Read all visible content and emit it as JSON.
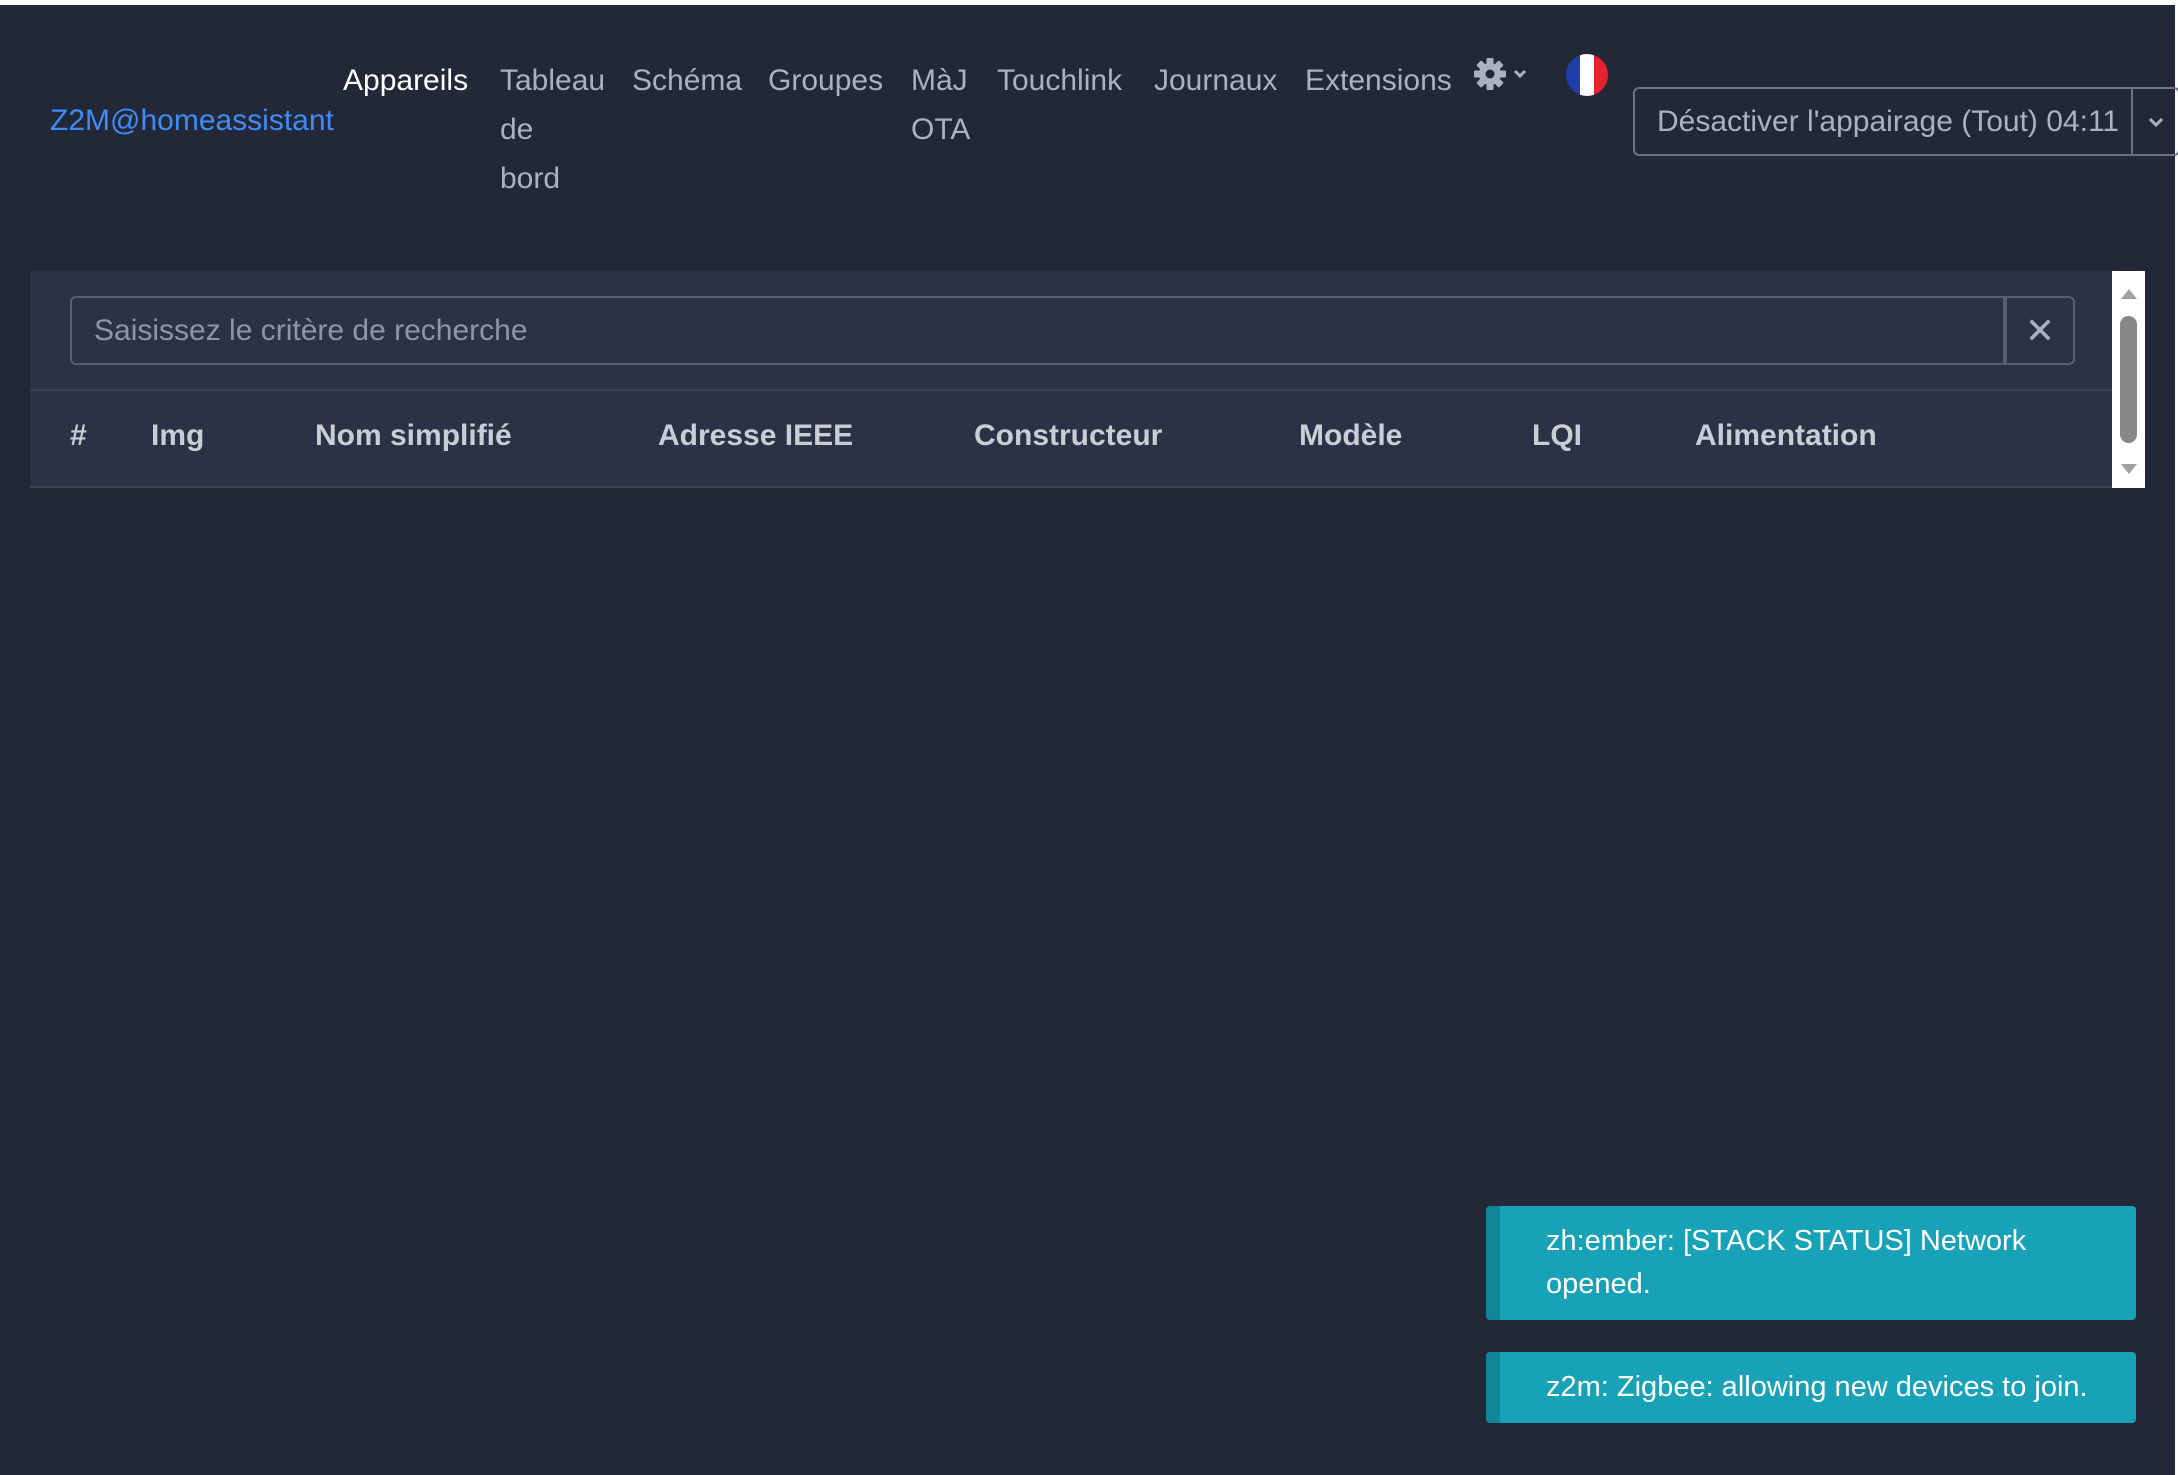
{
  "brand": "Z2M@homeassistant",
  "nav": {
    "items": [
      {
        "lines": [
          "Appareils"
        ],
        "active": true
      },
      {
        "lines": [
          "Tableau",
          "de",
          "bord"
        ],
        "active": false
      },
      {
        "lines": [
          "Schéma"
        ],
        "active": false
      },
      {
        "lines": [
          "Groupes"
        ],
        "active": false
      },
      {
        "lines": [
          "MàJ",
          "OTA"
        ],
        "active": false
      },
      {
        "lines": [
          "Touchlink"
        ],
        "active": false
      },
      {
        "lines": [
          "Journaux"
        ],
        "active": false
      },
      {
        "lines": [
          "Extensions"
        ],
        "active": false
      }
    ],
    "settings_icon": "gear-icon",
    "language_icon": "flag-fr-icon",
    "flag_colors": [
      "#1f3fa8",
      "#ffffff",
      "#e5222d"
    ]
  },
  "pairing": {
    "label": "Désactiver l'appairage (Tout) 04:11"
  },
  "search": {
    "placeholder": "Saisissez le critère de recherche",
    "value": "",
    "clear_symbol": "✕"
  },
  "table": {
    "headers": [
      "#",
      "Img",
      "Nom simplifié",
      "Adresse IEEE",
      "Constructeur",
      "Modèle",
      "LQI",
      "Alimentation"
    ],
    "rows": []
  },
  "toasts": [
    {
      "text": "zh:ember: [STACK STATUS] Network opened."
    },
    {
      "text": "z2m: Zigbee: allowing new devices to join."
    }
  ],
  "colors": {
    "background": "#222838",
    "card": "#2b3246",
    "brand": "#3f8cf5",
    "toast": "#17a2b8"
  }
}
